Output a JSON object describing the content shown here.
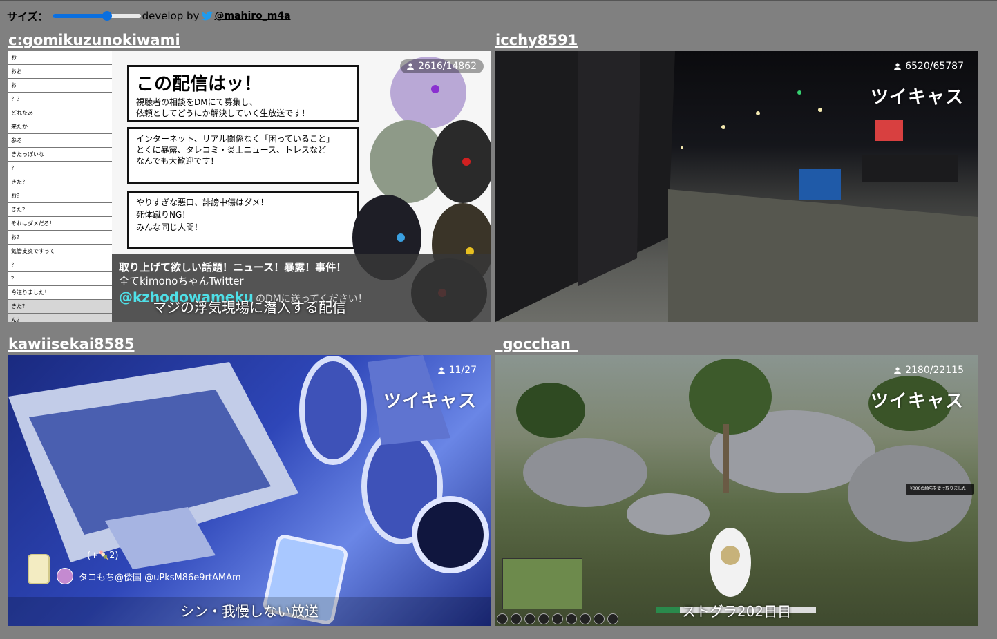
{
  "toolbar": {
    "size_label": "サイズ：",
    "size_value": 0.62,
    "develop_by": "develop by",
    "twitter_handle": "@mahiro_m4a"
  },
  "streams": [
    {
      "name": "c:gomikuzunokiwami",
      "viewers": "2616/14862",
      "caption": "マジの浮気現場に潜入する配信",
      "comments": [
        "お",
        "おお",
        "お",
        "？？",
        "どれたあ",
        "来たか",
        "参る",
        "きたっぽいな",
        "？",
        "きた？",
        "お？",
        "きた？",
        "それはダメだろ！",
        "お？",
        "気管支炎ですって",
        "？",
        "？",
        "今送りました！",
        "きた？",
        "ん？"
      ],
      "board1_title": "この配信はッ！",
      "board1_line1": "視聴者の相談をDMにて募集し、",
      "board1_line2": "依頼としてどうにか解決していく生放送です！",
      "board2_line1": "インターネット、リアル関係なく「困っていること」",
      "board2_line2": "とくに暴露、タレコミ・炎上ニュース、トレスなど",
      "board2_line3": "なんでも大歓迎です！",
      "board3_line1": "やりすぎな悪口、誹謗中傷はダメ！",
      "board3_line2": "死体蹴りNG！",
      "board3_line3": "みんな同じ人間！",
      "banner_line1": "取り上げて欲しい話題！ニュース！暴露！事件！",
      "banner_line2": "全てkimonoちゃんTwitter",
      "banner_handle": "@kzhodowameku",
      "banner_tail": "のDMに送ってください！"
    },
    {
      "name": "icchy8591",
      "viewers": "6520/65787",
      "logo": "ツイキャス"
    },
    {
      "name": "kawiisekai8585",
      "viewers": "11/27",
      "logo": "ツイキャス",
      "gift_count": "(+🍡2)",
      "gift_user": "タコもち@倭国 @uPksM86e9rtAMAm",
      "caption": "シン・我慢しない放送"
    },
    {
      "name": "_gocchan_",
      "viewers": "2180/22115",
      "logo": "ツイキャス",
      "notice": "¥000の給与を受け取りました",
      "caption": "ストグラ202日目",
      "progress": 0.15
    }
  ],
  "colors": {
    "page_bg": "#808080",
    "slider_accent": "#0a6fe0",
    "twitter_blue": "#1d9bf0"
  }
}
